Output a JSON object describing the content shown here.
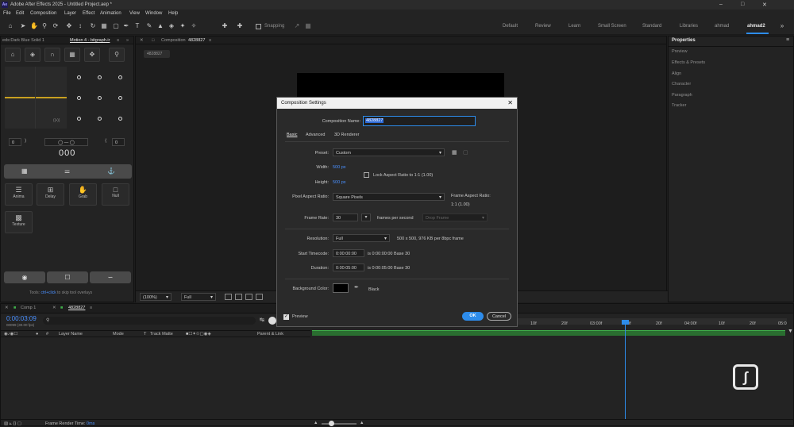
{
  "window": {
    "app_badge": "Ae",
    "title": "Adobe After Effects 2025 - Untitled Project.aep *"
  },
  "menu": [
    "File",
    "Edit",
    "Composition",
    "Layer",
    "Effect",
    "Animation",
    "View",
    "Window",
    "Help"
  ],
  "toolbar": {
    "snapping_label": "Snapping"
  },
  "workspaces": [
    "Default",
    "Review",
    "Learn",
    "Small Screen",
    "Standard",
    "Libraries",
    "ahmad",
    "ahmad2"
  ],
  "workspaces_active": "ahmad2",
  "left_panel": {
    "tab_inactive": "eds:Dark Blue Solid 1",
    "tab_active": "Motion 4 - bitgraph.ir",
    "num_left": "0",
    "num_right": "0",
    "big_readout": "000",
    "tools": [
      {
        "label": "Anima",
        "icon": "anima-icon"
      },
      {
        "label": "Delay",
        "icon": "delay-icon"
      },
      {
        "label": "Grab",
        "icon": "grab-icon"
      },
      {
        "label": "Null",
        "icon": "null-icon"
      },
      {
        "label": "Texture",
        "icon": "texture-icon"
      }
    ],
    "hint_prefix": "Tools:",
    "hint_key": "ctrl+click",
    "hint_rest": "to skip tool overlays"
  },
  "comp_panel": {
    "tab_label": "Composition",
    "tab_name": "4828827",
    "crumb": "4828827",
    "zoom": "(100%)",
    "res": "Full"
  },
  "right_panel": {
    "title": "Properties",
    "items": [
      "Preview",
      "Effects & Presets",
      "Align",
      "Character",
      "Paragraph",
      "Tracker"
    ]
  },
  "dialog": {
    "title": "Composition Settings",
    "comp_name_label": "Composition Name:",
    "comp_name_value": "4828827",
    "tabs": [
      "Basic",
      "Advanced",
      "3D Renderer"
    ],
    "preset_label": "Preset:",
    "preset_value": "Custom",
    "width_label": "Width:",
    "width_value": "500 px",
    "lock_label": "Lock Aspect Ratio to 1:1 (1.00)",
    "height_label": "Height:",
    "height_value": "500 px",
    "par_label": "Pixel Aspect Ratio:",
    "par_value": "Square Pixels",
    "far_label": "Frame Aspect Ratio:",
    "far_value": "1:1 (1.00)",
    "fps_label": "Frame Rate:",
    "fps_value": "30",
    "fps_unit": "frames per second",
    "drop_frame": "Drop Frame",
    "resolution_label": "Resolution:",
    "resolution_value": "Full",
    "resolution_info": "500 x 500, 976 KB per 8bpc frame",
    "start_tc_label": "Start Timecode:",
    "start_tc_value": "0:00:00:00",
    "start_tc_info": "is 0:00:00:00  Base 30",
    "duration_label": "Duration:",
    "duration_value": "0:00:05:00",
    "duration_info": "is 0:00:05:00  Base 30",
    "bg_label": "Background Color:",
    "bg_name": "Black",
    "bg_color": "#000000",
    "preview_label": "Preview",
    "ok_label": "OK",
    "cancel_label": "Cancel"
  },
  "timeline": {
    "tab_inactive": "Comp 1",
    "tab_active": "4828827",
    "timecode": "0:00:03:09",
    "frame_info": "00099 (30.00 fps)",
    "columns": [
      "#",
      "Layer Name",
      "Mode",
      "T",
      "Track Matte",
      "Parent & Link"
    ],
    "ruler": [
      "10f",
      "20f",
      "03:00f",
      "10f",
      "20f",
      "04:00f",
      "10f",
      "20f",
      "05:0"
    ],
    "render_label": "Frame Render Time:",
    "render_value": "0ms"
  },
  "colors": {
    "accent": "#2d8ceb",
    "timecode": "#4a90ff",
    "track": "#3fae49",
    "playhead": "#2d8ceb"
  }
}
